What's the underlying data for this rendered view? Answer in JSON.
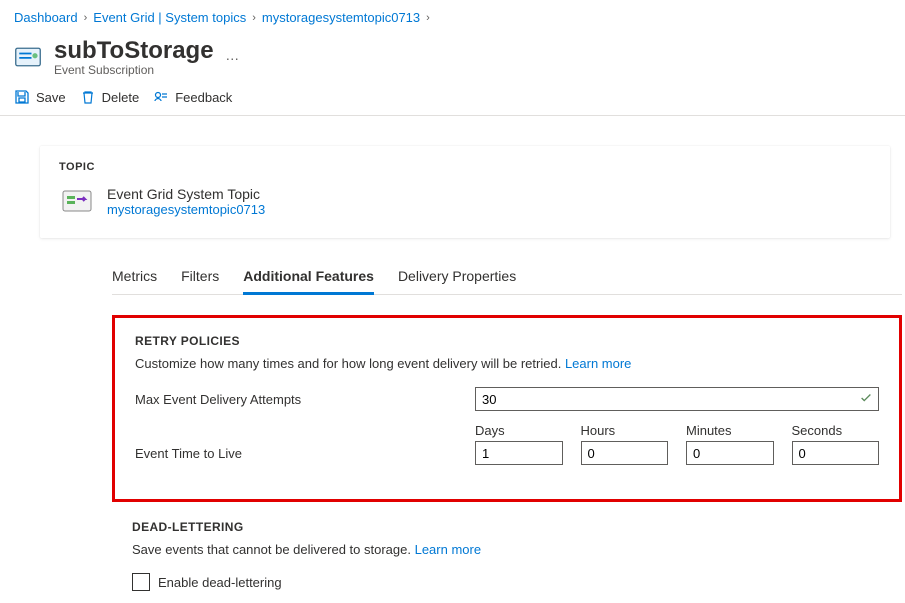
{
  "breadcrumb": {
    "items": [
      {
        "label": "Dashboard"
      },
      {
        "label": "Event Grid | System topics"
      },
      {
        "label": "mystoragesystemtopic0713"
      }
    ]
  },
  "header": {
    "title": "subToStorage",
    "subtitle": "Event Subscription"
  },
  "toolbar": {
    "save": "Save",
    "delete": "Delete",
    "feedback": "Feedback"
  },
  "topic": {
    "label": "TOPIC",
    "type": "Event Grid System Topic",
    "name": "mystoragesystemtopic0713"
  },
  "tabs": {
    "items": [
      {
        "label": "Metrics",
        "active": false
      },
      {
        "label": "Filters",
        "active": false
      },
      {
        "label": "Additional Features",
        "active": true
      },
      {
        "label": "Delivery Properties",
        "active": false
      }
    ]
  },
  "retry": {
    "title": "RETRY POLICIES",
    "desc": "Customize how many times and for how long event delivery will be retried.",
    "learn": "Learn more",
    "maxAttemptsLabel": "Max Event Delivery Attempts",
    "maxAttemptsValue": "30",
    "ttlLabel": "Event Time to Live",
    "ttl": {
      "daysLabel": "Days",
      "daysValue": "1",
      "hoursLabel": "Hours",
      "hoursValue": "0",
      "minutesLabel": "Minutes",
      "minutesValue": "0",
      "secondsLabel": "Seconds",
      "secondsValue": "0"
    }
  },
  "deadletter": {
    "title": "DEAD-LETTERING",
    "desc": "Save events that cannot be delivered to storage.",
    "learn": "Learn more",
    "checkboxLabel": "Enable dead-lettering",
    "checked": false
  }
}
